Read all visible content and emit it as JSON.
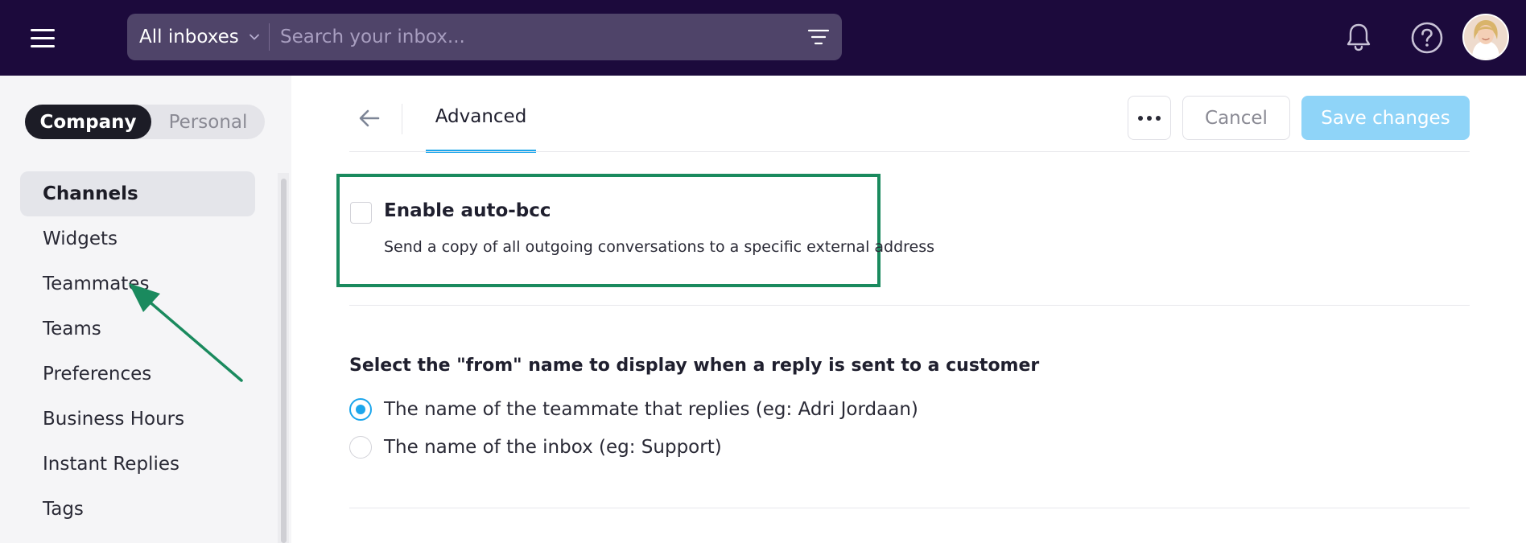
{
  "topbar": {
    "inbox_select": "All inboxes",
    "search_placeholder": "Search your inbox..."
  },
  "sidebar": {
    "segment": {
      "company": "Company",
      "personal": "Personal",
      "selected": "Company"
    },
    "items": [
      {
        "label": "Channels",
        "active": true
      },
      {
        "label": "Widgets"
      },
      {
        "label": "Teammates"
      },
      {
        "label": "Teams"
      },
      {
        "label": "Preferences"
      },
      {
        "label": "Business Hours"
      },
      {
        "label": "Instant Replies"
      },
      {
        "label": "Tags"
      }
    ]
  },
  "header": {
    "tab_label": "Advanced",
    "cancel_label": "Cancel",
    "save_label": "Save changes"
  },
  "auto_bcc": {
    "title": "Enable auto-bcc",
    "description": "Send a copy of all outgoing conversations to a specific external address",
    "checked": false
  },
  "from_name": {
    "title": "Select the \"from\" name to display when a reply is sent to a customer",
    "options": [
      {
        "label": "The name of the teammate that replies (eg: Adri Jordaan)",
        "selected": true
      },
      {
        "label": "The name of the inbox (eg: Support)",
        "selected": false
      }
    ]
  },
  "colors": {
    "topbar": "#1c0a3c",
    "search": "#4f4469",
    "accent": "#1ca6ec",
    "save_disabled": "#8fd4f8",
    "highlight": "#1a8a5e"
  }
}
